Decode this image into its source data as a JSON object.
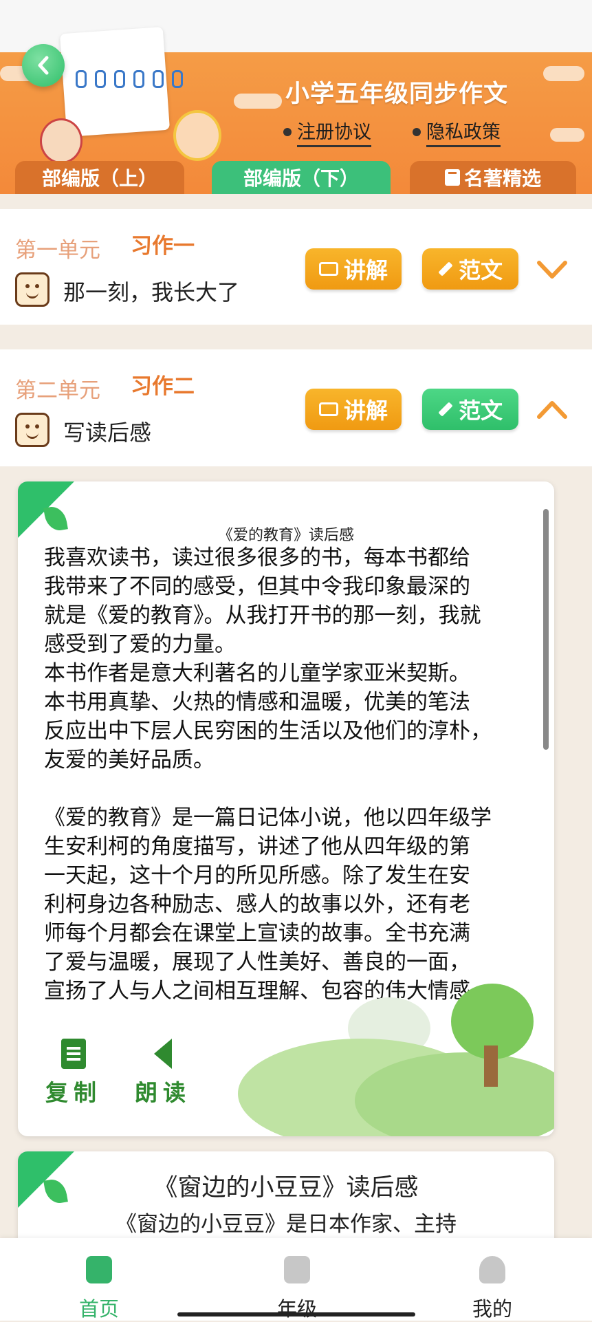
{
  "header": {
    "title": "小学五年级同步作文",
    "links": [
      "注册协议",
      "隐私政策"
    ],
    "tabs": [
      {
        "label": "部编版（上）"
      },
      {
        "label": "部编版（下）",
        "active": true
      },
      {
        "label": "名著精选"
      }
    ]
  },
  "units": [
    {
      "unit": "第一单元",
      "tag": "习作一",
      "title": "那一刻，我长大了",
      "explain_label": "讲解",
      "sample_label": "范文",
      "expanded": false
    },
    {
      "unit": "第二单元",
      "tag": "习作二",
      "title": "写读后感",
      "explain_label": "讲解",
      "sample_label": "范文",
      "expanded": true
    }
  ],
  "essay1": {
    "title": "《爱的教育》读后感",
    "body": "我喜欢读书，读过很多很多的书，每本书都给\n我带来了不同的感受，但其中令我印象最深的\n就是《爱的教育》。从我打开书的那一刻，我就\n感受到了爱的力量。\n本书作者是意大利著名的儿童学家亚米契斯。\n本书用真挚、火热的情感和温暖，优美的笔法\n反应出中下层人民穷困的生活以及他们的淳朴，\n友爱的美好品质。\n\n《爱的教育》是一篇日记体小说，他以四年级学\n生安利柯的角度描写，讲述了他从四年级的第\n一天起，这十个月的所见所感。除了发生在安\n利柯身边各种励志、感人的故事以外，还有老\n师每个月都会在课堂上宣读的故事。全书充满\n了爱与温暖，展现了人性美好、善良的一面，\n宣扬了人与人之间相互理解、包容的伟大情感，",
    "copy_label": "复制",
    "read_label": "朗读"
  },
  "essay2": {
    "title": "《窗边的小豆豆》读后感",
    "preview": "《窗边的小豆豆》是日本作家、主持"
  },
  "bottom_nav": [
    {
      "label": "首页",
      "active": true,
      "icon": "backpack-icon"
    },
    {
      "label": "年级",
      "icon": "books-icon"
    },
    {
      "label": "我的",
      "icon": "graduate-icon"
    }
  ],
  "colors": {
    "orange": "#f3893a",
    "green": "#2fbf6a",
    "yellow": "#f8b52b"
  }
}
